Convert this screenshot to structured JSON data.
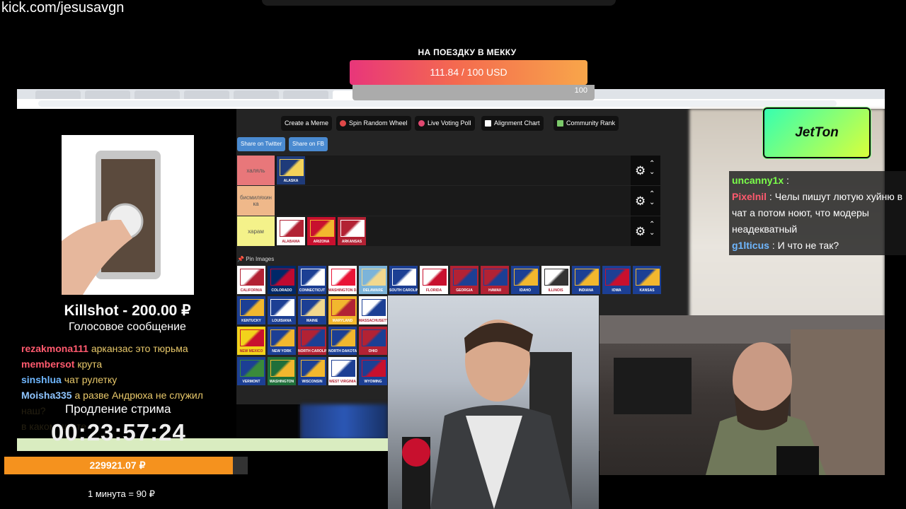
{
  "overlay_url": "kick.com/jesusavgn",
  "goal": {
    "title": "НА ПОЕЗДКУ В МЕККУ",
    "amount": "111.84 / 100 USD",
    "max": "100",
    "progress_fraction": 1.0
  },
  "browser": {
    "nav_buttons": [
      {
        "label": "Create a Meme",
        "icon": "none"
      },
      {
        "label": "Spin Random Wheel",
        "icon": "wheel-icon"
      },
      {
        "label": "Live Voting Poll",
        "icon": "poll-icon"
      },
      {
        "label": "Alignment Chart",
        "icon": "grid-icon"
      },
      {
        "label": "Community Rank",
        "icon": "rank-icon"
      }
    ],
    "share_buttons": [
      "Share on Twitter",
      "Share on FB"
    ],
    "tiers": [
      {
        "label": "халяль",
        "color": "#e8777a",
        "flags": [
          {
            "name": "ALASKA",
            "colors": [
              "#1f3b7a",
              "#f3d25a"
            ]
          }
        ]
      },
      {
        "label": "бисмиляхин ка",
        "color": "#efb88a",
        "flags": []
      },
      {
        "label": "харам",
        "color": "#f4f28a",
        "flags": [
          {
            "name": "ALABAMA",
            "colors": [
              "#ffffff",
              "#b22234"
            ]
          },
          {
            "name": "ARIZONA",
            "colors": [
              "#c8102e",
              "#f2b72e"
            ]
          },
          {
            "name": "ARKANSAS",
            "colors": [
              "#b22234",
              "#ffffff"
            ]
          }
        ]
      }
    ],
    "pin_label": "Pin Images",
    "pin_flags": [
      {
        "name": "CALIFORNIA",
        "colors": [
          "#ffffff",
          "#b22234"
        ]
      },
      {
        "name": "COLORADO",
        "colors": [
          "#002868",
          "#bf0a30"
        ]
      },
      {
        "name": "CONNECTICUT",
        "colors": [
          "#1c3f94",
          "#ffffff"
        ]
      },
      {
        "name": "WASHINGTON D.C.",
        "colors": [
          "#ffffff",
          "#e91436"
        ]
      },
      {
        "name": "DELAWARE",
        "colors": [
          "#7cb4d9",
          "#f2d88e"
        ]
      },
      {
        "name": "SOUTH CAROLINA",
        "colors": [
          "#1c3f94",
          "#ffffff"
        ]
      },
      {
        "name": "FLORIDA",
        "colors": [
          "#ffffff",
          "#c8102e"
        ]
      },
      {
        "name": "GEORGIA",
        "colors": [
          "#b22234",
          "#1c3f94"
        ]
      },
      {
        "name": "HAWAII",
        "colors": [
          "#b22234",
          "#1c3f94"
        ]
      },
      {
        "name": "IDAHO",
        "colors": [
          "#1c3f94",
          "#f2b72e"
        ]
      },
      {
        "name": "ILLINOIS",
        "colors": [
          "#ffffff",
          "#333333"
        ]
      },
      {
        "name": "INDIANA",
        "colors": [
          "#1c3f94",
          "#f2b72e"
        ]
      },
      {
        "name": "IOWA",
        "colors": [
          "#1c3f94",
          "#c8102e"
        ]
      },
      {
        "name": "KANSAS",
        "colors": [
          "#1c3f94",
          "#f2b72e"
        ]
      },
      {
        "name": "KENTUCKY",
        "colors": [
          "#1c3f94",
          "#f2b72e"
        ]
      },
      {
        "name": "LOUISIANA",
        "colors": [
          "#1c3f94",
          "#ffffff"
        ]
      },
      {
        "name": "MAINE",
        "colors": [
          "#1c3f94",
          "#f2d88e"
        ]
      },
      {
        "name": "MARYLAND",
        "colors": [
          "#f2b72e",
          "#b22234"
        ]
      },
      {
        "name": "MASSACHUSETTS",
        "colors": [
          "#ffffff",
          "#1c3f94"
        ]
      },
      {
        "name": "NEW MEXICO",
        "colors": [
          "#f2d31b",
          "#c8102e"
        ]
      },
      {
        "name": "NEW YORK",
        "colors": [
          "#1c3f94",
          "#f2b72e"
        ]
      },
      {
        "name": "NORTH CAROLINA",
        "colors": [
          "#b22234",
          "#1c3f94"
        ]
      },
      {
        "name": "NORTH DAKOTA",
        "colors": [
          "#1c3f94",
          "#f2b72e"
        ]
      },
      {
        "name": "OHIO",
        "colors": [
          "#b22234",
          "#1c3f94"
        ]
      },
      {
        "name": "VERMONT",
        "colors": [
          "#1c3f94",
          "#3a8a3a"
        ]
      },
      {
        "name": "WASHINGTON",
        "colors": [
          "#1f6f3a",
          "#f2b72e"
        ]
      },
      {
        "name": "WISCONSIN",
        "colors": [
          "#1c3f94",
          "#f2b72e"
        ]
      },
      {
        "name": "WEST VIRGINIA",
        "colors": [
          "#ffffff",
          "#1c3f94"
        ]
      },
      {
        "name": "WYOMING",
        "colors": [
          "#1c3f94",
          "#c8102e"
        ]
      }
    ]
  },
  "sponsor": {
    "logo_text": "JetTon"
  },
  "right_chat": [
    {
      "user": "uncanny1x",
      "color": "#7bff4a",
      "message": ""
    },
    {
      "user": "Pixelnil",
      "color": "#ff5a6e",
      "message": "Челы пишут лютую хуйню в чат а потом ноют, что модеры неадекватный"
    },
    {
      "user": "g1lticus",
      "color": "#6fb7ff",
      "message": "И что не так?"
    }
  ],
  "donation": {
    "title": "Killshot - 200.00 ₽",
    "subtitle": "Голосовое сообщение"
  },
  "left_chat": [
    {
      "user": "rezakmona111",
      "color": "#ff5a6e",
      "message": "арканзас это тюрьма"
    },
    {
      "user": "membersot",
      "color": "#ff5a6e",
      "message": "крута"
    },
    {
      "user": "sinshlua",
      "color": "#6fb7ff",
      "message": "чат рулетку"
    },
    {
      "user": "Moisha335",
      "color": "#8fc5ff",
      "message": "а разве Андрюха не служил наш?"
    },
    {
      "user": "",
      "color": "#cccccc",
      "message": "в каком штате"
    }
  ],
  "subathon": {
    "label": "Продление стрима",
    "timer": "00:23:57:24",
    "total": "229921.07 ₽",
    "progress_fraction": 0.94,
    "rate": "1 минута = 90 ₽"
  }
}
